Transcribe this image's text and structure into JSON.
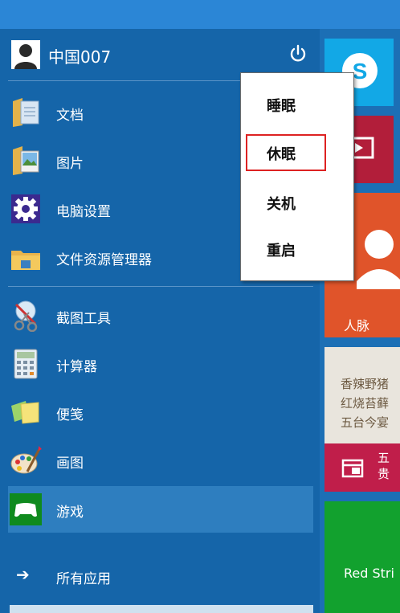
{
  "user": {
    "name": "中国007"
  },
  "places": [
    {
      "label": "文档",
      "icon": "folder-documents-icon"
    },
    {
      "label": "图片",
      "icon": "folder-pictures-icon"
    },
    {
      "label": "电脑设置",
      "icon": "gear-icon"
    },
    {
      "label": "文件资源管理器",
      "icon": "file-explorer-icon"
    }
  ],
  "apps": [
    {
      "label": "截图工具",
      "icon": "snipping-tool-icon"
    },
    {
      "label": "计算器",
      "icon": "calculator-icon"
    },
    {
      "label": "便笺",
      "icon": "sticky-notes-icon"
    },
    {
      "label": "画图",
      "icon": "paint-icon"
    },
    {
      "label": "游戏",
      "icon": "game-controller-icon"
    }
  ],
  "all_apps": {
    "label": "所有应用"
  },
  "power_menu": {
    "options": [
      {
        "label": "睡眠"
      },
      {
        "label": "休眠",
        "highlighted": true
      },
      {
        "label": "关机"
      },
      {
        "label": "重启"
      }
    ]
  },
  "tiles": {
    "people": {
      "label": "人脉",
      "color": "#e0542a"
    },
    "recipe": {
      "lines": [
        "香辣野猪",
        "红烧苔藓",
        "五台今宴"
      ],
      "caption_1": "五",
      "caption_2": "贵"
    },
    "red_stripe": {
      "label": "Red Stri"
    }
  },
  "colors": {
    "menu_bg": "#1565a9",
    "active_item": "#2e7ebf",
    "skype_tile": "#12a8e6",
    "video_tile": "#b21e3a",
    "people_tile": "#e0542a",
    "recipe_band": "#c01e4a",
    "green_tile": "#12a12e",
    "highlight_border": "#d22222"
  }
}
